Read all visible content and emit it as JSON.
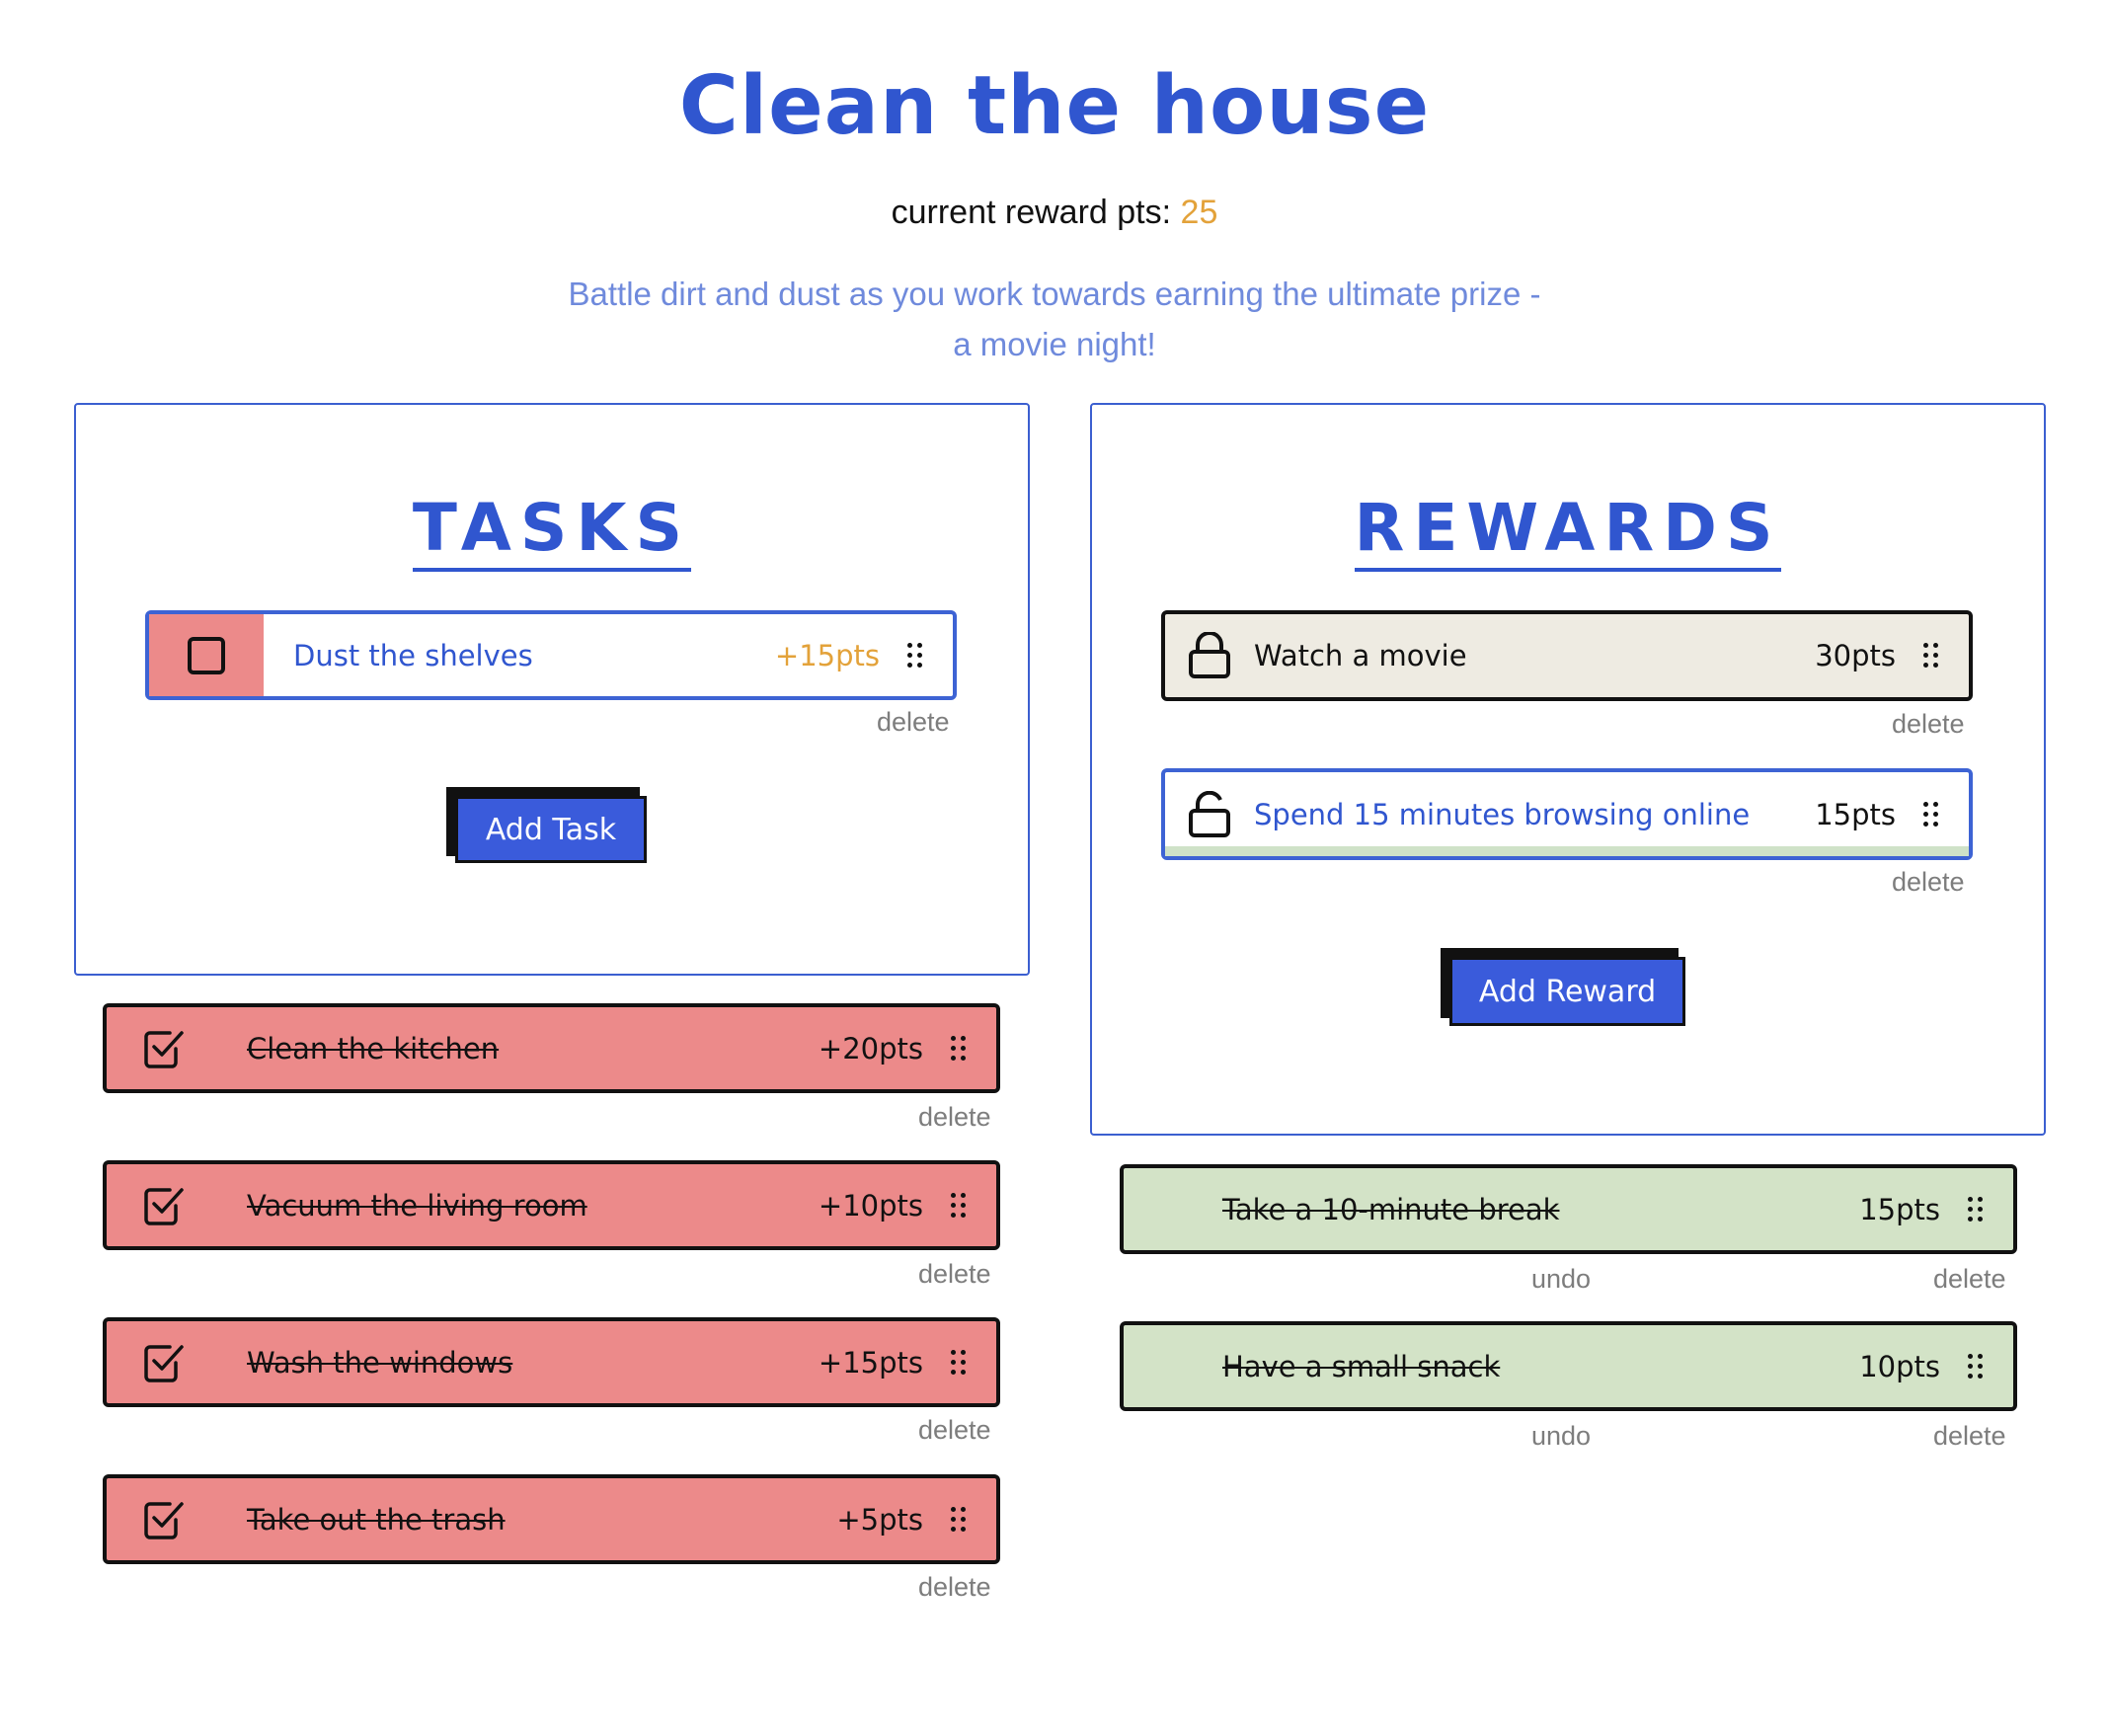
{
  "header": {
    "title": "Clean the house",
    "points_label": "current reward pts:",
    "points_value": "25",
    "description": "Battle dirt and dust as you work towards earning the ultimate prize - a movie night!"
  },
  "tasks": {
    "heading": "TASKS",
    "active": [
      {
        "label": "Dust the shelves",
        "points": "+15pts",
        "delete": "delete"
      }
    ],
    "add_button": "Add Task",
    "completed": [
      {
        "label": "Clean the kitchen",
        "points": "+20pts",
        "delete": "delete"
      },
      {
        "label": "Vacuum the living room",
        "points": "+10pts",
        "delete": "delete"
      },
      {
        "label": "Wash the windows",
        "points": "+15pts",
        "delete": "delete"
      },
      {
        "label": "Take out the trash",
        "points": "+5pts",
        "delete": "delete"
      }
    ]
  },
  "rewards": {
    "heading": "REWARDS",
    "available": [
      {
        "label": "Watch a movie",
        "points": "30pts",
        "delete": "delete",
        "icon": "lock-closed-icon"
      },
      {
        "label": "Spend 15 minutes browsing online",
        "points": "15pts",
        "delete": "delete",
        "icon": "lock-open-icon"
      }
    ],
    "add_button": "Add Reward",
    "redeemed": [
      {
        "label": "Take a 10-minute break",
        "points": "15pts",
        "undo": "undo",
        "delete": "delete"
      },
      {
        "label": "Have a small snack",
        "points": "10pts",
        "undo": "undo",
        "delete": "delete"
      }
    ]
  },
  "colors": {
    "accent": "#3056cf",
    "points": "#e3a23a",
    "task_red": "#ec8a8a",
    "reward_green": "#d3e3c7",
    "locked_beige": "#eeebe2"
  }
}
